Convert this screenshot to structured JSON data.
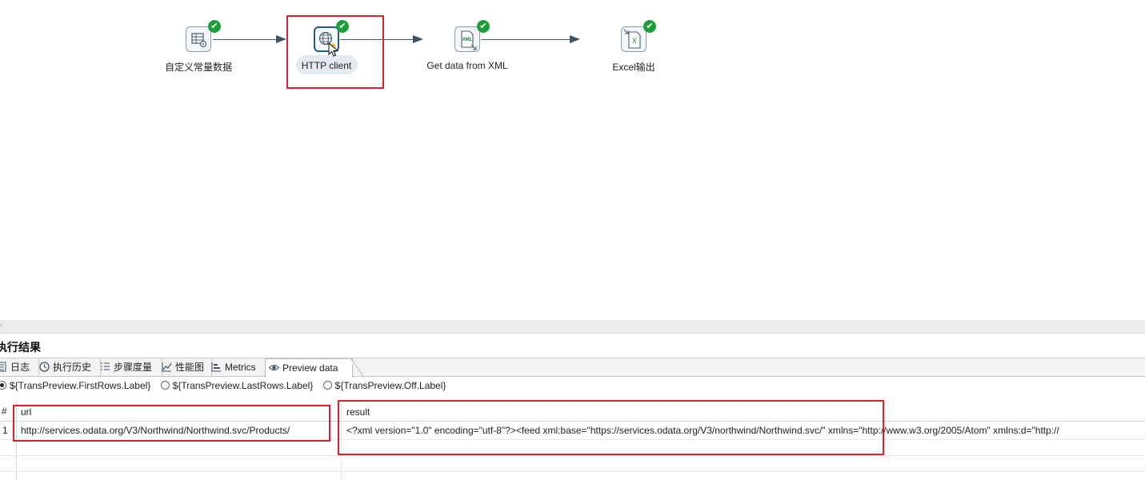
{
  "flow": {
    "steps": [
      {
        "id": "const",
        "label": "自定义常量数据",
        "icon": "table-gear-icon"
      },
      {
        "id": "http",
        "label": "HTTP client",
        "icon": "globe-icon"
      },
      {
        "id": "xml",
        "label": "Get data from XML",
        "icon": "xml-file-icon",
        "icon_text": "XML"
      },
      {
        "id": "excel",
        "label": "Excel输出",
        "icon": "excel-file-icon",
        "icon_text": "X"
      }
    ],
    "check_symbol": "✔",
    "accent": "#1e9e3a",
    "highlight": "#d6232c"
  },
  "results_panel": {
    "title": "执行结果",
    "tabs": [
      {
        "label": "日志",
        "icon": "log-icon"
      },
      {
        "label": "执行历史",
        "icon": "history-icon"
      },
      {
        "label": "步骤度量",
        "icon": "step-metrics-icon"
      },
      {
        "label": "性能图",
        "icon": "performance-chart-icon"
      },
      {
        "label": "Metrics",
        "icon": "metrics-icon"
      },
      {
        "label": "Preview data",
        "icon": "eye-icon",
        "active": true
      }
    ],
    "preview_options": [
      {
        "label": "${TransPreview.FirstRows.Label}",
        "selected": true
      },
      {
        "label": "${TransPreview.LastRows.Label}",
        "selected": false
      },
      {
        "label": "${TransPreview.Off.Label}",
        "selected": false
      }
    ],
    "table": {
      "rownum_header": "#",
      "columns": [
        "url",
        "result"
      ],
      "rows": [
        {
          "num": "1",
          "url": "http://services.odata.org/V3/Northwind/Northwind.svc/Products/",
          "result": "<?xml version=\"1.0\" encoding=\"utf-8\"?><feed xml:base=\"https://services.odata.org/V3/northwind/Northwind.svc/\" xmlns=\"http://www.w3.org/2005/Atom\" xmlns:d=\"http://"
        }
      ]
    }
  }
}
